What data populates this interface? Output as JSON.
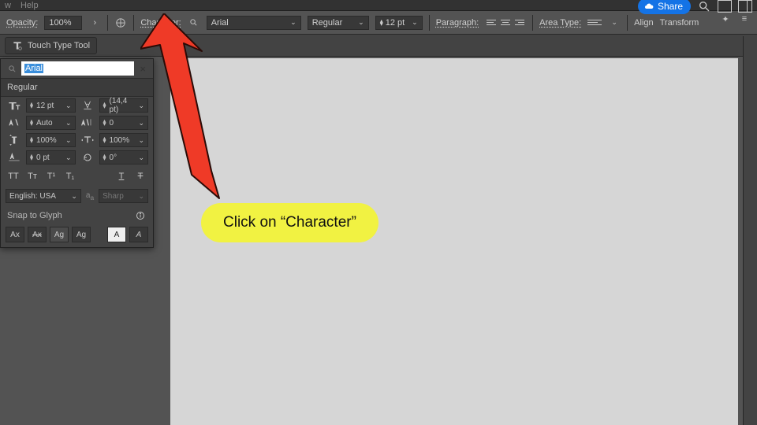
{
  "menu": {
    "view": "w",
    "help": "Help"
  },
  "share": {
    "label": "Share"
  },
  "control": {
    "opacity_label": "Opacity:",
    "opacity_value": "100%",
    "character_label": "Character:",
    "font": "Arial",
    "style": "Regular",
    "size": "12 pt",
    "paragraph_label": "Paragraph:",
    "area_type_label": "Area Type:",
    "align_label": "Align",
    "transform_label": "Transform"
  },
  "toolrow": {
    "touch_type": "Touch Type Tool"
  },
  "panel": {
    "search_value": "Arial",
    "style": "Regular",
    "size": "12 pt",
    "leading": "(14,4 pt)",
    "kerning": "Auto",
    "tracking": "0",
    "vscale": "100%",
    "hscale": "100%",
    "baseline": "0 pt",
    "rotation": "0°",
    "language": "English: USA",
    "aa": "Sharp",
    "snap_label": "Snap to Glyph",
    "glyphs": [
      "Ax",
      "Ax",
      "Ag",
      "Ag",
      "A",
      "A"
    ]
  },
  "callout": {
    "text": "Click on “Character”"
  }
}
